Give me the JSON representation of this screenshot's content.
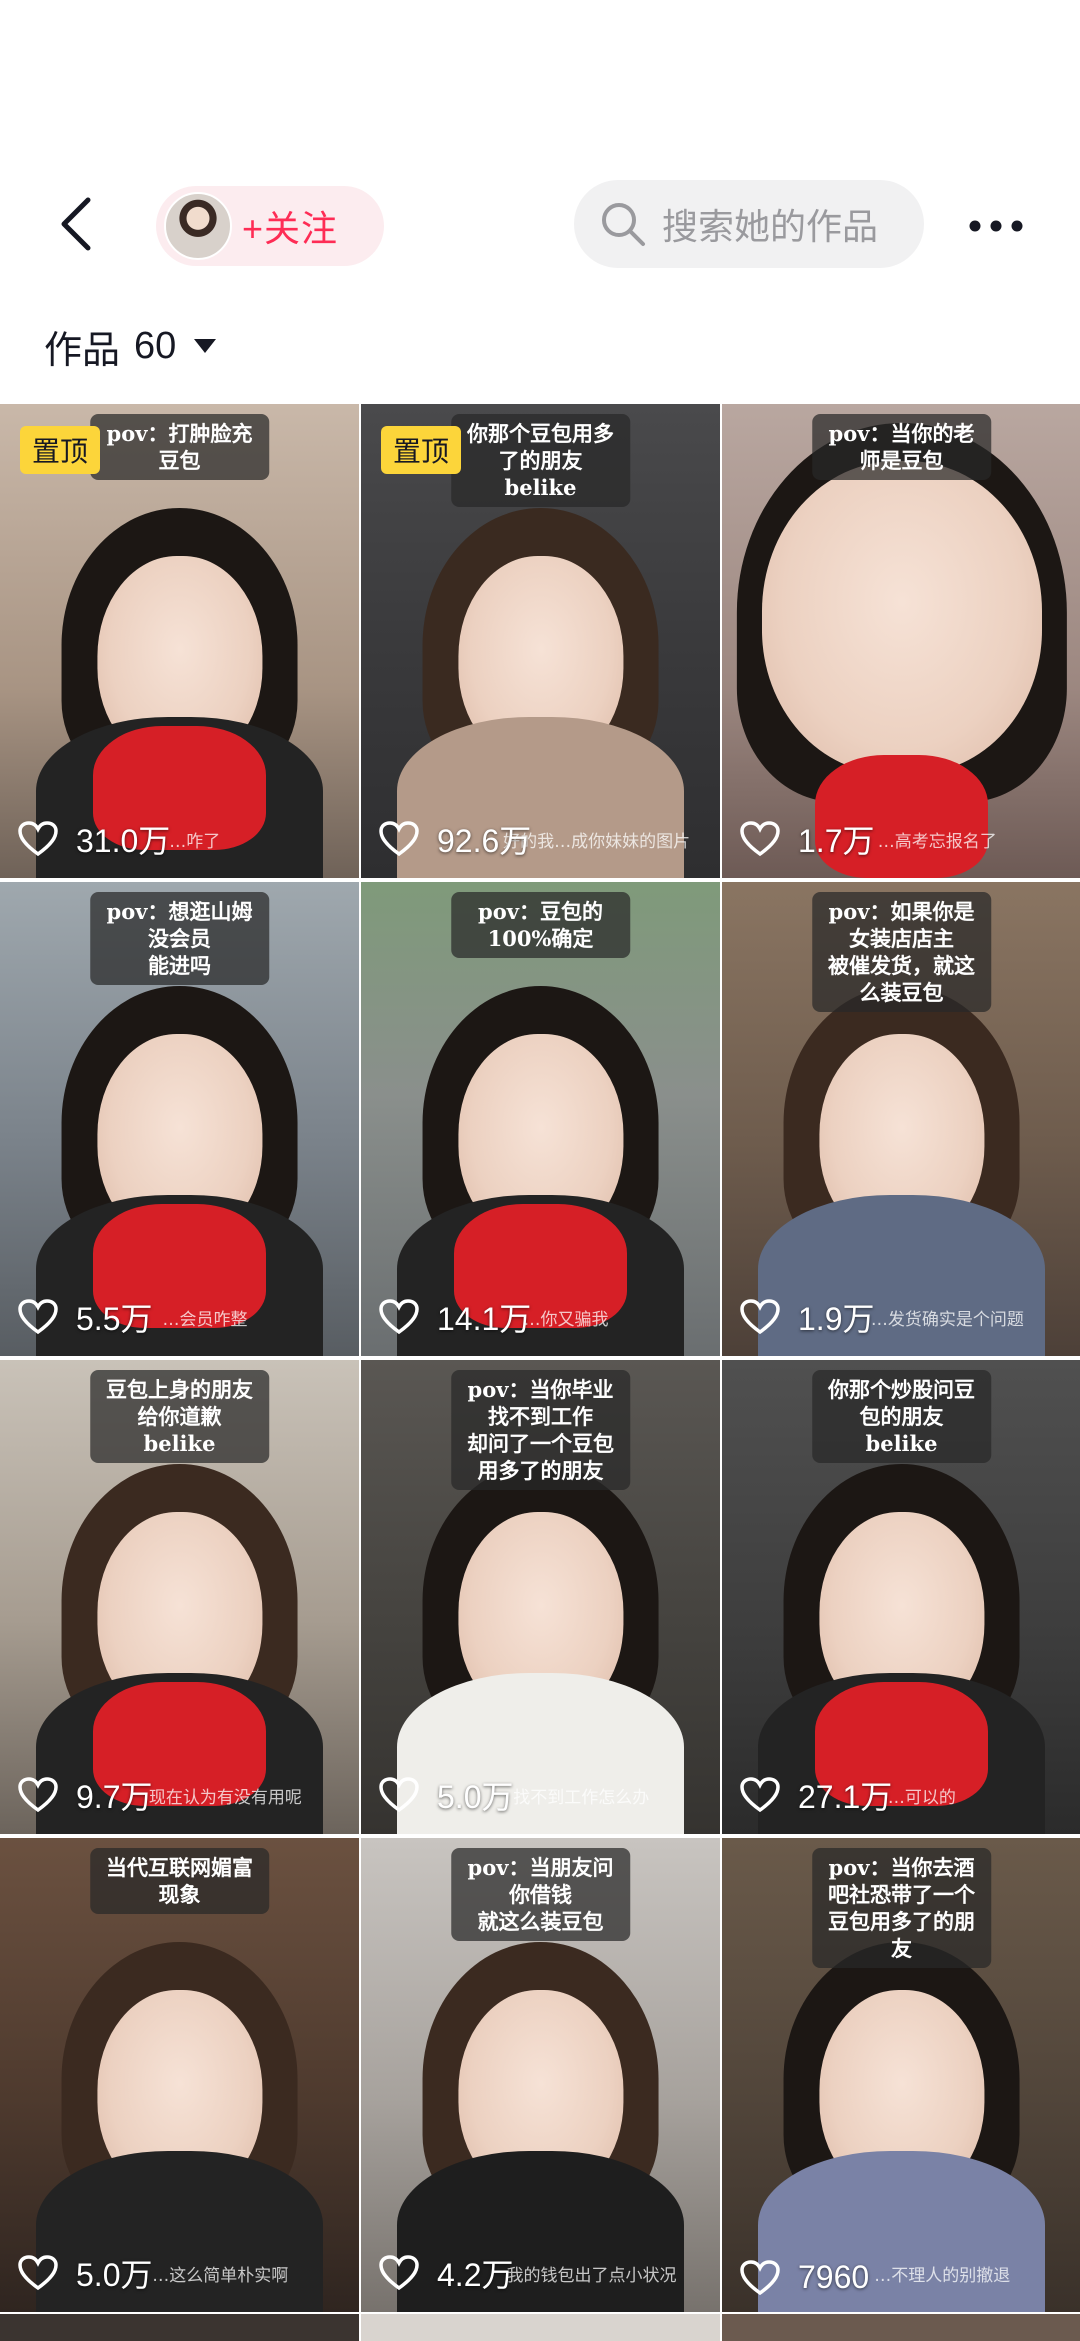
{
  "header": {
    "follow_label": "+关注",
    "search_placeholder": "搜索她的作品"
  },
  "works": {
    "title": "作品",
    "count": "60"
  },
  "colors": {
    "accent": "#fe2c55",
    "pinned_badge": "#fcd53a",
    "scarf": "#d61f26"
  },
  "grid": [
    {
      "caption": "pov：打肿脸充豆包",
      "pinned": "置顶",
      "likes": "31.0万",
      "subtitle": "…咋了"
    },
    {
      "caption": "你那个豆包用多了的朋友\nbelike",
      "pinned": "置顶",
      "likes": "92.6万",
      "subtitle": "好的我…成你妹妹的图片"
    },
    {
      "caption": "pov：当你的老师是豆包",
      "pinned": "",
      "likes": "1.7万",
      "subtitle": "…高考忘报名了"
    },
    {
      "caption": "pov：想逛山姆没会员\n能进吗",
      "pinned": "",
      "likes": "5.5万",
      "subtitle": "…会员咋整"
    },
    {
      "caption": "pov：豆包的100%确定",
      "pinned": "",
      "likes": "14.1万",
      "subtitle": "…你又骗我"
    },
    {
      "caption": "pov：如果你是女装店店主\n被催发货，就这么装豆包",
      "pinned": "",
      "likes": "1.9万",
      "subtitle": "…发货确实是个问题"
    },
    {
      "caption": "豆包上身的朋友给你道歉\nbelike",
      "pinned": "",
      "likes": "9.7万",
      "subtitle": "现在认为有没有用呢"
    },
    {
      "caption": "pov：当你毕业找不到工作\n却问了一个豆包用多了的朋友",
      "pinned": "",
      "likes": "5.0万",
      "subtitle": "找不到工作怎么办"
    },
    {
      "caption": "你那个炒股问豆包的朋友\nbelike",
      "pinned": "",
      "likes": "27.1万",
      "subtitle": "…可以的"
    },
    {
      "caption": "当代互联网媚富现象",
      "pinned": "",
      "likes": "5.0万",
      "subtitle": "…这么简单朴实啊"
    },
    {
      "caption": "pov：当朋友问你借钱\n就这么装豆包",
      "pinned": "",
      "likes": "4.2万",
      "subtitle": "我的钱包出了点小状况"
    },
    {
      "caption": "pov：当你去酒吧社恐带了一个\n豆包用多了的朋友",
      "pinned": "",
      "likes": "7960",
      "subtitle": "…不理人的别撤退"
    }
  ]
}
